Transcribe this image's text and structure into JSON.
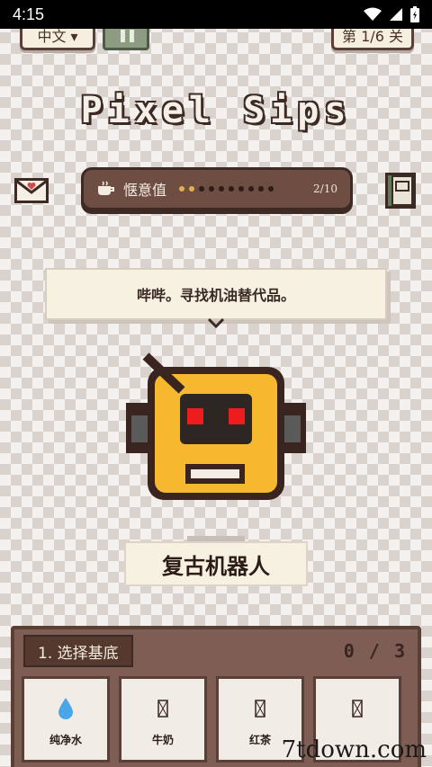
{
  "status_bar": {
    "time": "4:15"
  },
  "top": {
    "language_label": "中文 ▾",
    "level_label": "第 1/6 关"
  },
  "app_title": "Pixel Sips",
  "comfort": {
    "label": "惬意值",
    "filled": 2,
    "total": 10,
    "count_text": "2/10"
  },
  "speech_text": "哔哔。寻找机油替代品。",
  "customer_name": "复古机器人",
  "step_panel": {
    "header": "1. 选择基底",
    "count": "0 / 3",
    "items": [
      {
        "label": "纯净水",
        "icon": "water-drop-icon"
      },
      {
        "label": "牛奶",
        "icon": "missing-glyph-icon"
      },
      {
        "label": "红茶",
        "icon": "missing-glyph-icon"
      },
      {
        "label": "",
        "icon": "missing-glyph-icon"
      }
    ]
  },
  "watermark": "7tdown.com",
  "colors": {
    "accent_gold": "#e7b04a",
    "robot_yellow": "#f5b82e",
    "panel_brown": "#7e5e54",
    "eye_red": "#ee1c1c"
  }
}
